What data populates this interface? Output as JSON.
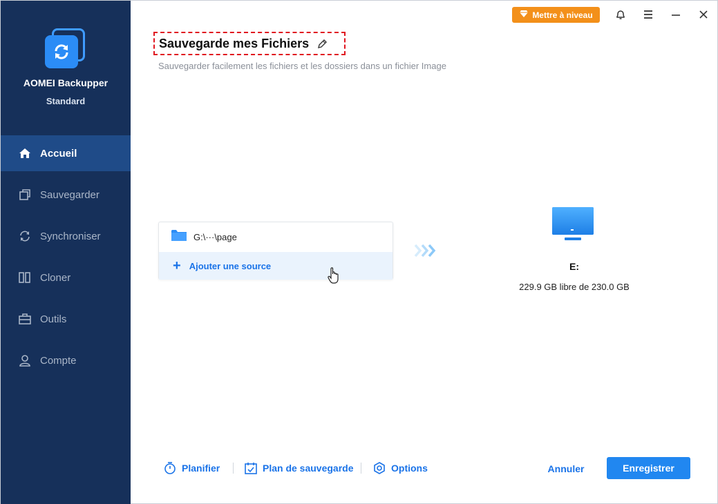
{
  "app": {
    "name": "AOMEI Backupper",
    "edition": "Standard"
  },
  "sidebar": {
    "items": [
      {
        "label": "Accueil",
        "icon": "home-icon",
        "active": true
      },
      {
        "label": "Sauvegarder",
        "icon": "backup-icon",
        "active": false
      },
      {
        "label": "Synchroniser",
        "icon": "sync-icon",
        "active": false
      },
      {
        "label": "Cloner",
        "icon": "clone-icon",
        "active": false
      },
      {
        "label": "Outils",
        "icon": "toolbox-icon",
        "active": false
      },
      {
        "label": "Compte",
        "icon": "user-icon",
        "active": false
      }
    ]
  },
  "topbar": {
    "upgrade_label": "Mettre à niveau"
  },
  "main": {
    "title": "Sauvegarde mes Fichiers",
    "subtitle": "Sauvegarder facilement les fichiers et les dossiers dans un fichier Image",
    "source": {
      "path": "G:\\···\\page",
      "add_label": "Ajouter une source"
    },
    "destination": {
      "drive": "E:",
      "space": "229.9 GB libre de 230.0 GB"
    }
  },
  "bottom": {
    "schedule_label": "Planifier",
    "plan_label": "Plan de sauvegarde",
    "options_label": "Options",
    "cancel_label": "Annuler",
    "save_label": "Enregistrer"
  },
  "colors": {
    "sidebar_bg": "#16305a",
    "sidebar_active": "#1f4b88",
    "accent": "#2187f0",
    "upgrade": "#f3901a",
    "title_border": "#e0141e"
  }
}
